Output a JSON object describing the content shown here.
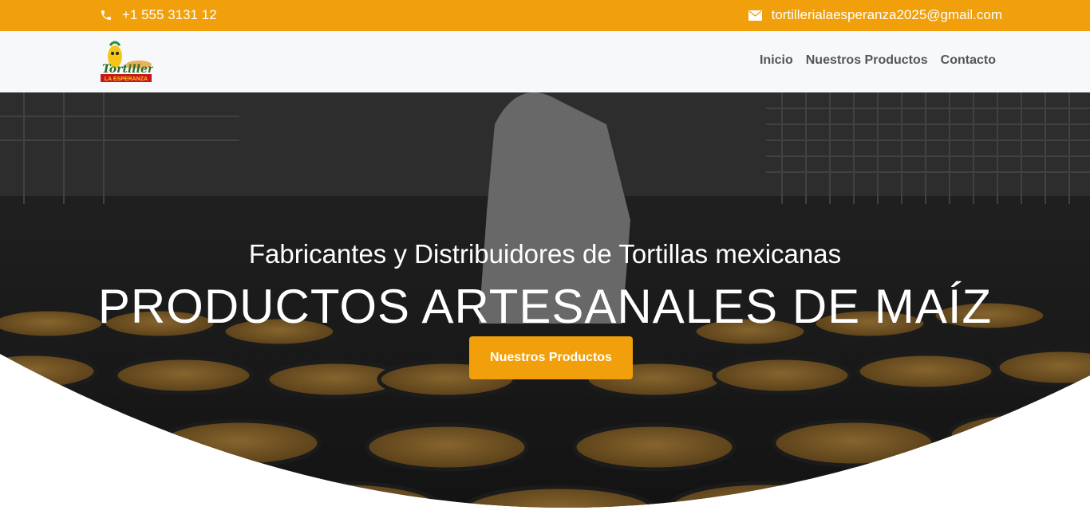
{
  "topbar": {
    "phone": "+1 555 3131 12",
    "email": "tortillerialaesperanza2025@gmail.com",
    "phone_icon": "phone-icon",
    "email_icon": "envelope-icon"
  },
  "brand": {
    "logo_text_top": "Tortillería",
    "logo_text_bottom": "LA ESPERANZA"
  },
  "nav": {
    "items": [
      {
        "label": "Inicio"
      },
      {
        "label": "Nuestros Productos"
      },
      {
        "label": "Contacto"
      }
    ]
  },
  "hero": {
    "subtitle": "Fabricantes y Distribuidores de Tortillas mexicanas",
    "title": "PRODUCTOS ARTESANALES DE MAÍZ",
    "cta_label": "Nuestros Productos"
  },
  "colors": {
    "accent": "#f1a00b",
    "navbar_bg": "#f7f8fa",
    "nav_text": "#555555"
  }
}
